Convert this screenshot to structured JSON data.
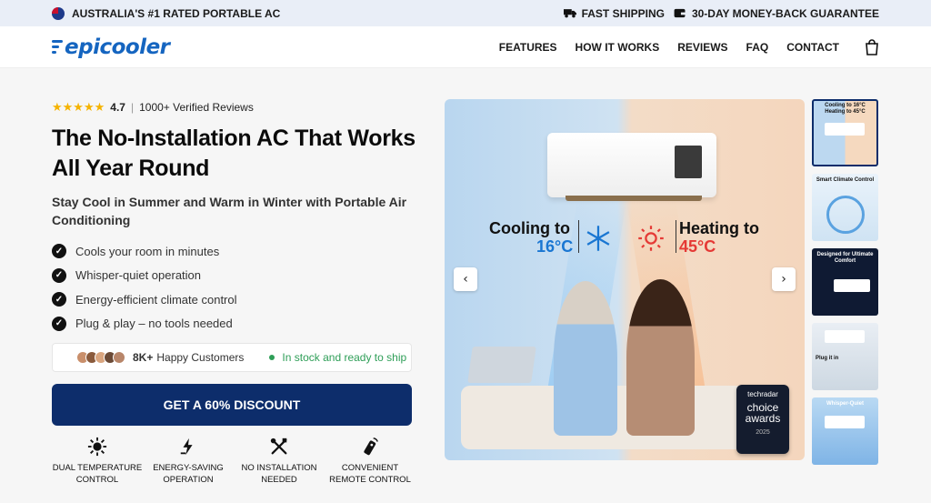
{
  "topbar": {
    "left_text": "AUSTRALIA'S #1 RATED PORTABLE AC",
    "shipping": "FAST SHIPPING",
    "guarantee": "30-DAY MONEY-BACK GUARANTEE"
  },
  "header": {
    "logo_text": "epicooler",
    "nav": [
      {
        "label": "FEATURES"
      },
      {
        "label": "HOW IT WORKS"
      },
      {
        "label": "REVIEWS"
      },
      {
        "label": "FAQ"
      },
      {
        "label": "CONTACT"
      }
    ]
  },
  "hero_left": {
    "rating_value": "4.7",
    "rating_stars": 4.7,
    "rating_sep": "|",
    "reviews_text": "1000+ Verified Reviews",
    "headline": "The No-Installation AC That Works All Year Round",
    "subheadline": "Stay Cool in Summer and Warm in Winter with Portable Air Conditioning",
    "bullets": [
      "Cools your room in minutes",
      "Whisper-quiet operation",
      "Energy-efficient climate control",
      "Plug & play – no tools needed"
    ],
    "customers_count": "8K+",
    "customers_label": "Happy Customers",
    "stock_text": "In stock and ready to ship",
    "cta_label": "GET A 60% DISCOUNT",
    "features": [
      {
        "icon": "sun-snowflake-icon",
        "label": "DUAL TEMPERATURE CONTROL"
      },
      {
        "icon": "energy-saving-icon",
        "label": "ENERGY-SAVING OPERATION"
      },
      {
        "icon": "no-tools-icon",
        "label": "NO INSTALLATION NEEDED"
      },
      {
        "icon": "remote-control-icon",
        "label": "CONVENIENT REMOTE CONTROL"
      }
    ]
  },
  "hero_image": {
    "cooling_label": "Cooling to",
    "cooling_temp": "16°C",
    "heating_label": "Heating to",
    "heating_temp": "45°C",
    "badge_brand": "techradar",
    "badge_title": "choice awards",
    "badge_year": "2025",
    "prev_symbol": "‹",
    "next_symbol": "›"
  },
  "thumbnails": [
    {
      "caption": "Cooling to 16°C  Heating to 45°C"
    },
    {
      "caption": "Smart Climate Control"
    },
    {
      "caption": "Designed for Ultimate Comfort"
    },
    {
      "caption": "Plug it in"
    },
    {
      "caption": "Whisper-Quiet"
    }
  ],
  "colors": {
    "primary": "#0d2d6b",
    "brand_blue": "#1565c0",
    "in_stock_green": "#2e9e57",
    "star_yellow": "#f5b301",
    "cool_blue": "#1976d2",
    "heat_red": "#e53935"
  }
}
